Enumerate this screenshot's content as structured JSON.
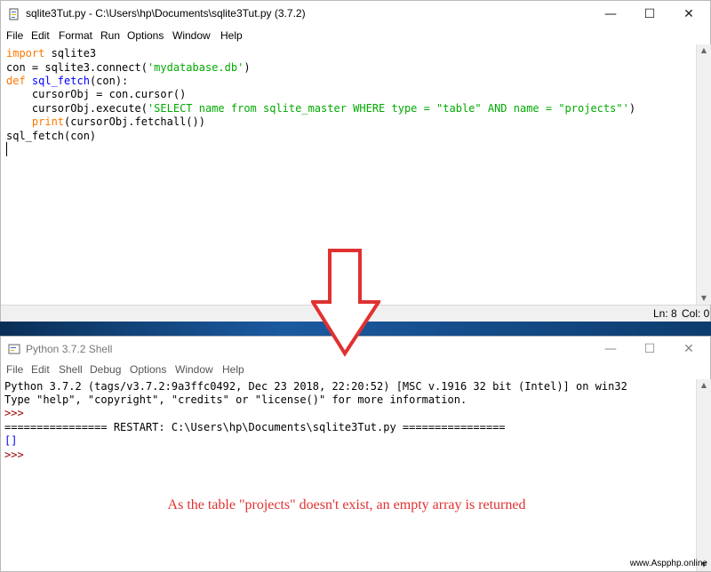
{
  "editor": {
    "title": "sqlite3Tut.py - C:\\Users\\hp\\Documents\\sqlite3Tut.py (3.7.2)",
    "menu": [
      "File",
      "Edit",
      "Format",
      "Run",
      "Options",
      "Window",
      "Help"
    ],
    "code": {
      "l1_kw": "import",
      "l1_rest": " sqlite3",
      "l2_a": "con = sqlite3.connect(",
      "l2_str": "'mydatabase.db'",
      "l2_b": ")",
      "l3_kw": "def",
      "l3_fn": " sql_fetch",
      "l3_rest": "(con):",
      "l4": "    cursorObj = con.cursor()",
      "l5_a": "    cursorObj.execute(",
      "l5_str": "'SELECT name from sqlite_master WHERE type = \"table\" AND name = \"projects\"'",
      "l5_b": ")",
      "l6_pad": "    ",
      "l6_kw": "print",
      "l6_rest": "(cursorObj.fetchall())",
      "l7": "sql_fetch(con)"
    },
    "status": {
      "line": "Ln: 8",
      "col": "Col: 0"
    }
  },
  "shell": {
    "title": "Python 3.7.2 Shell",
    "menu": [
      "File",
      "Edit",
      "Shell",
      "Debug",
      "Options",
      "Window",
      "Help"
    ],
    "lines": {
      "banner1": "Python 3.7.2 (tags/v3.7.2:9a3ffc0492, Dec 23 2018, 22:20:52) [MSC v.1916 32 bit (Intel)] on win32",
      "banner2": "Type \"help\", \"copyright\", \"credits\" or \"license()\" for more information.",
      "prompt1": ">>>",
      "restart": "================ RESTART: C:\\Users\\hp\\Documents\\sqlite3Tut.py ================",
      "result": "[]",
      "prompt2": ">>>"
    }
  },
  "annotation": "As the table \"projects\" doesn't exist, an empty array is returned",
  "watermark": "www.Aspphp.online",
  "window_controls": {
    "minimize": "—",
    "maximize": "☐",
    "close": "✕"
  },
  "colors": {
    "keyword": "#ff7700",
    "builtin_fn": "#0000ff",
    "string": "#00aa00",
    "annotation": "#e03131",
    "arrow": "#e03131"
  }
}
